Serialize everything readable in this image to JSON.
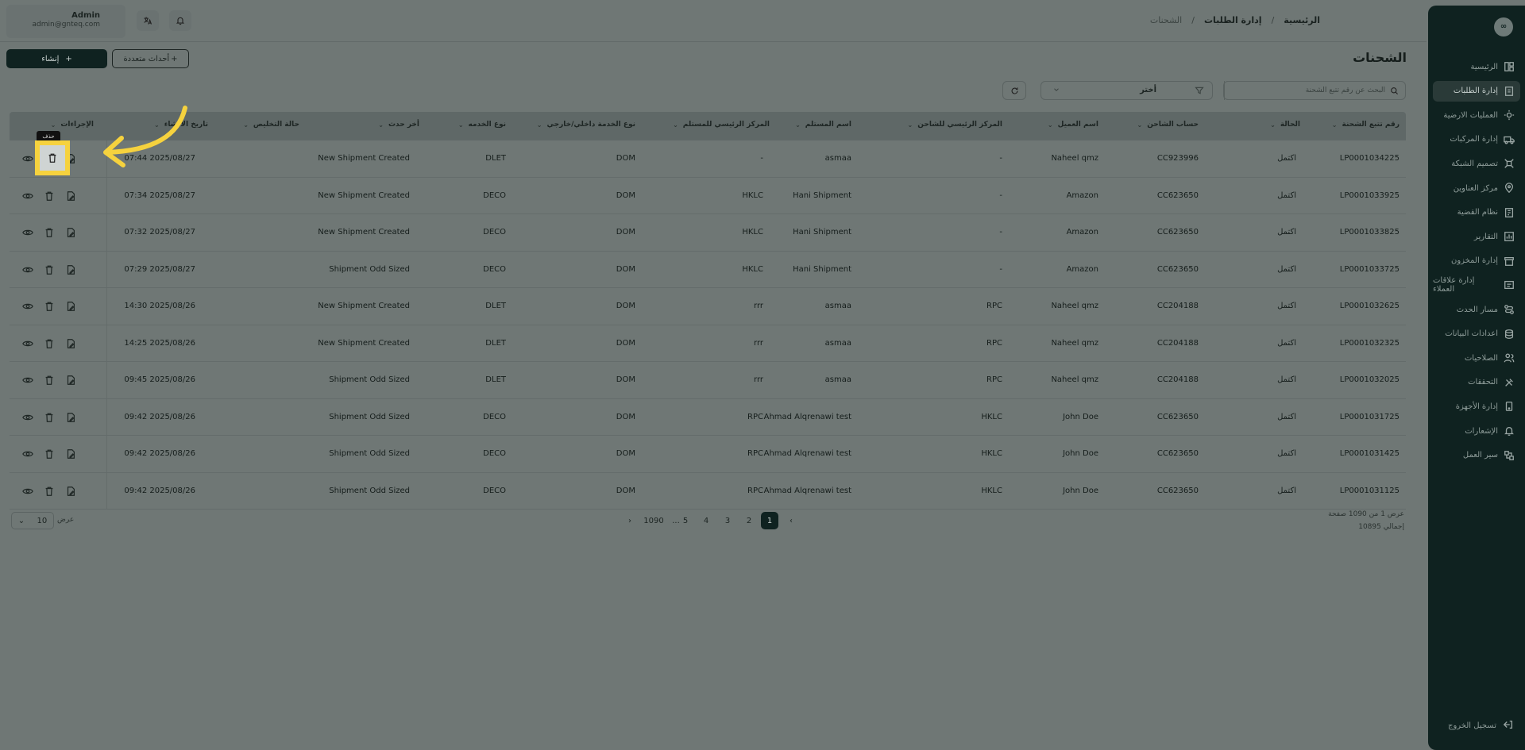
{
  "sidebar": {
    "logo": "∞",
    "items": [
      {
        "label": "الرئيسية",
        "icon": "dashboard-icon",
        "active": false
      },
      {
        "label": "إدارة الطلبات",
        "icon": "orders-icon",
        "active": true
      },
      {
        "label": "العمليات الارضية",
        "icon": "ground-ops-icon",
        "active": false
      },
      {
        "label": "إدارة المركبات",
        "icon": "truck-icon",
        "active": false
      },
      {
        "label": "تصميم الشبكة",
        "icon": "network-icon",
        "active": false
      },
      {
        "label": "مركز العناوين",
        "icon": "address-icon",
        "active": false
      },
      {
        "label": "نظام القضية",
        "icon": "case-icon",
        "active": false
      },
      {
        "label": "التقارير",
        "icon": "reports-icon",
        "active": false
      },
      {
        "label": "إدارة المخزون",
        "icon": "inventory-icon",
        "active": false
      },
      {
        "label": "إدارة علاقات العملاء",
        "icon": "crm-icon",
        "active": false
      },
      {
        "label": "مسار الحدث",
        "icon": "route-icon",
        "active": false
      },
      {
        "label": "اعدادات البيانات",
        "icon": "database-icon",
        "active": false
      },
      {
        "label": "الصلاحيات",
        "icon": "users-icon",
        "active": false
      },
      {
        "label": "التحققات",
        "icon": "tools-icon",
        "active": false
      },
      {
        "label": "إدارة الأجهزة",
        "icon": "devices-icon",
        "active": false
      },
      {
        "label": "الإشعارات",
        "icon": "bell-icon",
        "active": false
      },
      {
        "label": "سير العمل",
        "icon": "workflow-icon",
        "active": false
      }
    ],
    "logout": "تسجيل الخروج"
  },
  "header": {
    "user_name": "Admin",
    "user_email": "admin@gnteq.com",
    "breadcrumb": [
      "الرئيسية",
      "إدارة الطلبات",
      "الشحنات"
    ],
    "separator": "/"
  },
  "page": {
    "title": "الشحنات",
    "create_label": "إنشاء",
    "multi_events_label": "أحداث متعددة",
    "search_placeholder": "البحث عن رقم تتبع الشحنة",
    "select_value": "أختر"
  },
  "table": {
    "columns": [
      "رقم تتبع الشحنة",
      "الحالة",
      "حساب الشاحن",
      "اسم العميل",
      "المركز الرئيسي للشاحن",
      "اسم المستلم",
      "المركز الرئيسي للمستلم",
      "نوع الخدمة داخلي/خارجي",
      "نوع الخدمه",
      "أخر حدث",
      "حالة التخليص",
      "تاريخ الانشاء",
      "الإجراءات"
    ],
    "rows": [
      [
        "LP0001034225",
        "اكتمل",
        "CC923996",
        "Naheel qmz",
        "-",
        "asmaa",
        "-",
        "DOM",
        "DLET",
        "New Shipment Created",
        "",
        "07:44 2025/08/27"
      ],
      [
        "LP0001033925",
        "اكتمل",
        "CC623650",
        "Amazon",
        "-",
        "Hani Shipment",
        "HKLC",
        "DOM",
        "DECO",
        "New Shipment Created",
        "",
        "07:34 2025/08/27"
      ],
      [
        "LP0001033825",
        "اكتمل",
        "CC623650",
        "Amazon",
        "-",
        "Hani Shipment",
        "HKLC",
        "DOM",
        "DECO",
        "New Shipment Created",
        "",
        "07:32 2025/08/27"
      ],
      [
        "LP0001033725",
        "اكتمل",
        "CC623650",
        "Amazon",
        "-",
        "Hani Shipment",
        "HKLC",
        "DOM",
        "DECO",
        "Shipment Odd Sized",
        "",
        "07:29 2025/08/27"
      ],
      [
        "LP0001032625",
        "اكتمل",
        "CC204188",
        "Naheel qmz",
        "RPC",
        "asmaa",
        "rrr",
        "DOM",
        "DLET",
        "New Shipment Created",
        "",
        "14:30 2025/08/26"
      ],
      [
        "LP0001032325",
        "اكتمل",
        "CC204188",
        "Naheel qmz",
        "RPC",
        "asmaa",
        "rrr",
        "DOM",
        "DLET",
        "New Shipment Created",
        "",
        "14:25 2025/08/26"
      ],
      [
        "LP0001032025",
        "اكتمل",
        "CC204188",
        "Naheel qmz",
        "RPC",
        "asmaa",
        "rrr",
        "DOM",
        "DLET",
        "Shipment Odd Sized",
        "",
        "09:45 2025/08/26"
      ],
      [
        "LP0001031725",
        "اكتمل",
        "CC623650",
        "John Doe",
        "HKLC",
        "Ahmad Alqrenawi test",
        "RPC",
        "DOM",
        "DECO",
        "Shipment Odd Sized",
        "",
        "09:42 2025/08/26"
      ],
      [
        "LP0001031425",
        "اكتمل",
        "CC623650",
        "John Doe",
        "HKLC",
        "Ahmad Alqrenawi test",
        "RPC",
        "DOM",
        "DECO",
        "Shipment Odd Sized",
        "",
        "09:42 2025/08/26"
      ],
      [
        "LP0001031125",
        "اكتمل",
        "CC623650",
        "John Doe",
        "HKLC",
        "Ahmad Alqrenawi test",
        "RPC",
        "DOM",
        "DECO",
        "Shipment Odd Sized",
        "",
        "09:42 2025/08/26"
      ]
    ]
  },
  "pagination": {
    "info_line1": "عرض 1 من 1090 صفحة",
    "info_line2": "إجمالي 10895",
    "pages": [
      "1",
      "2",
      "3",
      "4",
      "5",
      "...",
      "1090"
    ],
    "current": "1",
    "per_page": "10",
    "per_page_label": "عرض"
  },
  "tooltip": "حذف",
  "colors": {
    "accent": "#0f2220",
    "highlight": "#f6d23e"
  }
}
